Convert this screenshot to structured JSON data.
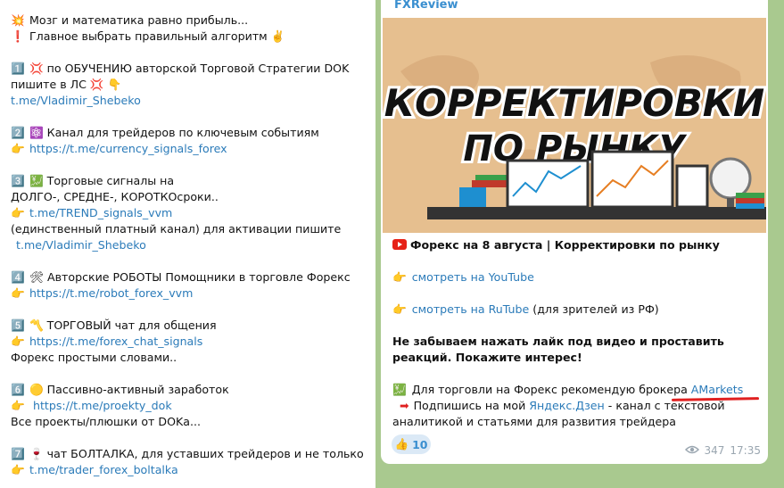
{
  "left": {
    "lines": [
      {
        "emoji": "💥",
        "text": "Мозг и математика равно прибыль..."
      },
      {
        "emoji": "❗",
        "text": "Главное выбрать правильный алгоритм ✌️"
      },
      null,
      {
        "emoji": "1️⃣",
        "text": "💢 по ОБУЧЕНИЮ авторской Торговой Стратегии DOK"
      },
      {
        "text": "пишите в ЛС 💢 👇"
      },
      {
        "link": "t.me/Vladimir_Shebeko"
      },
      null,
      {
        "emoji": "2️⃣",
        "text": "⚛️ Канал для трейдеров по ключевым событиям"
      },
      {
        "emoji": "👉",
        "link": "https://t.me/currency_signals_forex"
      },
      null,
      {
        "emoji": "3️⃣",
        "text": "💹 Торговые сигналы на"
      },
      {
        "text": "ДОЛГО-, СРЕДНЕ-, КОРОТКОсроки.."
      },
      {
        "emoji": "👉",
        "link": "t.me/TREND_signals_vvm"
      },
      {
        "text": "(единственный платный канал) для активации пишите"
      },
      {
        "link": "t.me/Vladimir_Shebeko",
        "indent": true
      },
      null,
      {
        "emoji": "4️⃣",
        "text": "🛠 Авторские РОБОТЫ  Помощники в торговле Форекс"
      },
      {
        "emoji": "👉",
        "link": "https://t.me/robot_forex_vvm"
      },
      null,
      {
        "emoji": "5️⃣",
        "text": "〽️ ТОРГОВЫЙ чат для общения"
      },
      {
        "emoji": "👉",
        "link": "https://t.me/forex_chat_signals"
      },
      {
        "text": "Форекс простыми словами.."
      },
      null,
      {
        "emoji": "6️⃣",
        "text": "🟡 Пассивно-активный заработок"
      },
      {
        "emoji": "👉",
        "link": " https://t.me/proekty_dok"
      },
      {
        "text": "Все проекты/плюшки от DOKа..."
      },
      null,
      {
        "emoji": "7️⃣",
        "text": "🍷 чат БОЛТАЛКА, для уставших трейдеров и не только"
      },
      {
        "emoji": "👉",
        "link": "t.me/trader_forex_boltalka"
      }
    ]
  },
  "post": {
    "author": "FXReview",
    "thumb_line1": "КОРРЕКТИРОВКИ",
    "thumb_line2": "ПО РЫНКУ",
    "title": "Форекс на 8 августа | Корректировки по рынку",
    "youtube_link": "смотреть на YouTube",
    "rutube_link": "смотреть на RuTube",
    "rutube_note": " (для зрителей из РФ)",
    "appeal": "Не забываем нажать лайк под видео и проставить реакций. Покажите интерес!",
    "broker_text": "Для торговли на Форекс рекомендую брокера ",
    "broker_link": "AMarkets",
    "dzen_pre": "Подпишись на мой ",
    "dzen_link": "Яндекс.Дзен",
    "dzen_post": " - канал с текстовой аналитикой и статьями для развития трейдера",
    "reaction_emoji": "👍",
    "reaction_count": "10",
    "views": "347",
    "time": "17:35"
  },
  "colors": {
    "link": "#2b7bb9",
    "accent": "#3a8fd0",
    "chat_bg": "#a9c98f",
    "thumb_bg": "#e6bf8f"
  }
}
